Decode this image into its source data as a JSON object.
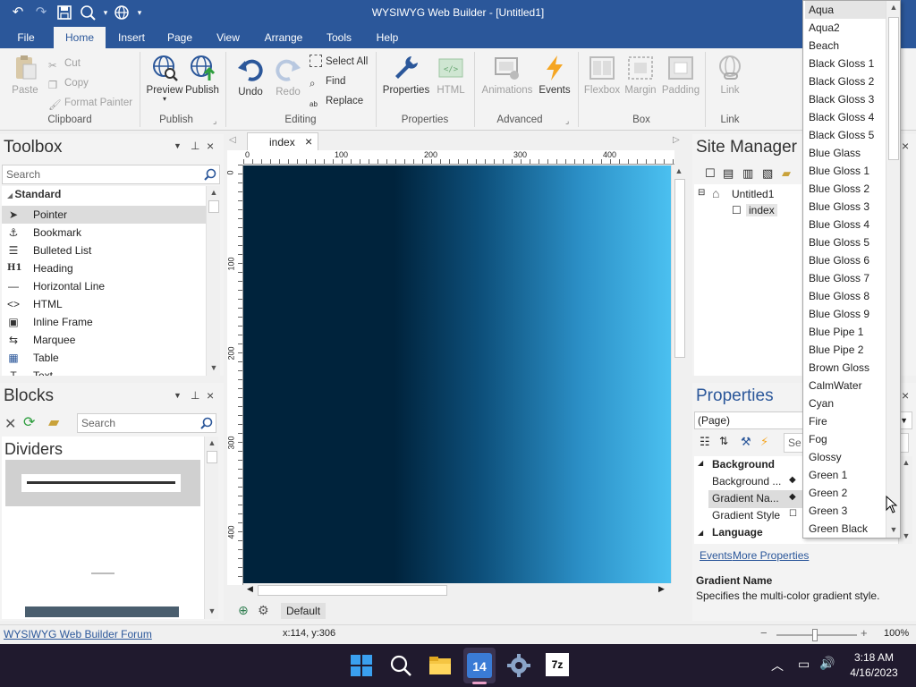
{
  "window": {
    "title": "WYSIWYG Web Builder - [Untitled1]"
  },
  "menu": {
    "tabs": [
      "File",
      "Home",
      "Insert",
      "Page",
      "View",
      "Arrange",
      "Tools",
      "Help"
    ]
  },
  "ribbon": {
    "clipboard": {
      "paste": "Paste",
      "cut": "Cut",
      "copy": "Copy",
      "format_painter": "Format Painter",
      "label": "Clipboard"
    },
    "publish": {
      "preview": "Preview",
      "publish": "Publish",
      "label": "Publish"
    },
    "editing": {
      "undo": "Undo",
      "redo": "Redo",
      "select_all": "Select All",
      "find": "Find",
      "replace": "Replace",
      "label": "Editing"
    },
    "properties": {
      "properties": "Properties",
      "html": "HTML",
      "label": "Properties"
    },
    "advanced": {
      "animations": "Animations",
      "events": "Events",
      "label": "Advanced"
    },
    "box": {
      "flexbox": "Flexbox",
      "margin": "Margin",
      "padding": "Padding",
      "label": "Box"
    },
    "link": {
      "link": "Link",
      "label": "Link"
    }
  },
  "toolbox": {
    "title": "Toolbox",
    "search_placeholder": "Search",
    "category": "Standard",
    "items": [
      "Pointer",
      "Bookmark",
      "Bulleted List",
      "Heading",
      "Horizontal Line",
      "HTML",
      "Inline Frame",
      "Marquee",
      "Table",
      "Text"
    ]
  },
  "blocks": {
    "title": "Blocks",
    "search_placeholder": "Search",
    "category": "Dividers"
  },
  "document": {
    "tab": "index",
    "ruler_h": [
      "0",
      "100",
      "200",
      "300",
      "400"
    ],
    "ruler_v": [
      "0",
      "100",
      "200",
      "300",
      "400"
    ],
    "bottom_tab": "Default"
  },
  "site_manager": {
    "title": "Site Manager",
    "tree_root": "Untitled1",
    "tree_child": "index"
  },
  "properties": {
    "title": "Properties",
    "selector": "(Page)",
    "search_placeholder": "Se",
    "section_background": "Background",
    "rows": [
      "Background ...",
      "Gradient Na...",
      "Gradient Style"
    ],
    "section_language": "Language",
    "links": {
      "events": "Events",
      "more": "More Properties"
    },
    "help_title": "Gradient Name",
    "help_text": "Specifies the multi-color gradient style."
  },
  "dropdown": {
    "items": [
      "Aqua",
      "Aqua2",
      "Beach",
      "Black Gloss 1",
      "Black Gloss 2",
      "Black Gloss 3",
      "Black Gloss 4",
      "Black Gloss 5",
      "Blue Glass",
      "Blue Gloss 1",
      "Blue Gloss 2",
      "Blue Gloss 3",
      "Blue Gloss 4",
      "Blue Gloss 5",
      "Blue Gloss 6",
      "Blue Gloss 7",
      "Blue Gloss 8",
      "Blue Gloss 9",
      "Blue Pipe 1",
      "Blue Pipe 2",
      "Brown Gloss",
      "CalmWater",
      "Cyan",
      "Fire",
      "Fog",
      "Glossy",
      "Green 1",
      "Green 2",
      "Green 3",
      "Green Black"
    ]
  },
  "status": {
    "link": "WYSIWYG Web Builder Forum",
    "coords": "x:114, y:306",
    "zoom": "100%"
  },
  "taskbar": {
    "time": "3:18 AM",
    "date": "4/16/2023",
    "app_badge": "14"
  },
  "colors": {
    "accent": "#2b579a",
    "gradient_dark": "#00233c",
    "gradient_light": "#4cc2f2",
    "taskbar": "#201a2e"
  }
}
